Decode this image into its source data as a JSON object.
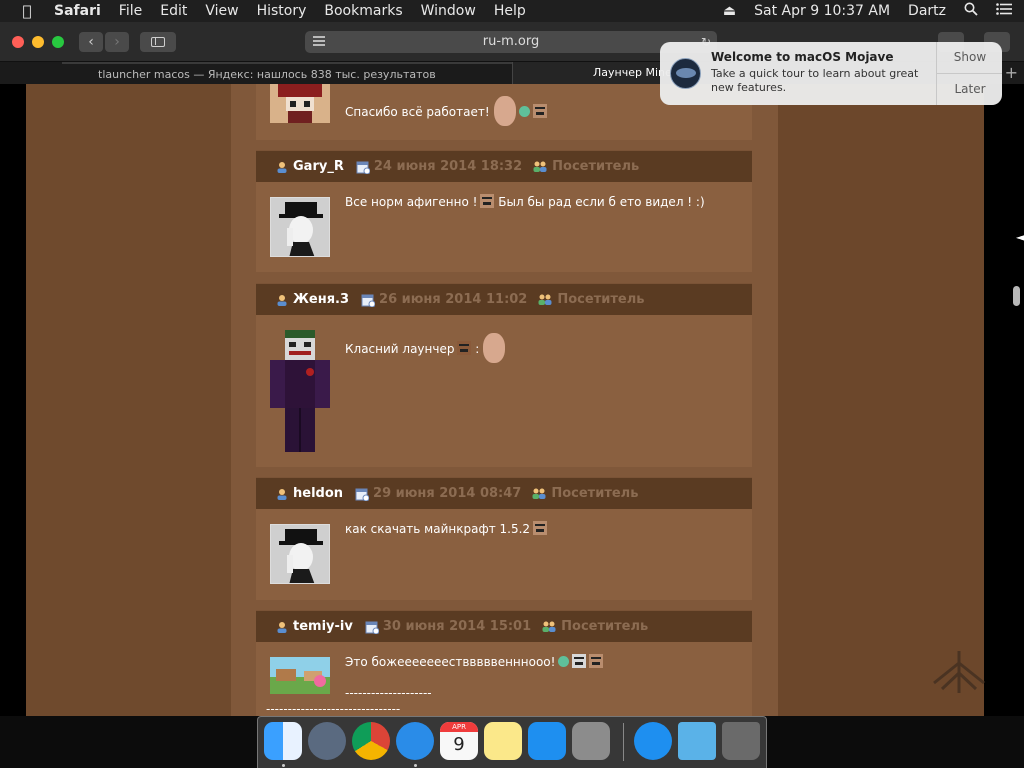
{
  "menubar": {
    "app": "Safari",
    "items": [
      "File",
      "Edit",
      "View",
      "History",
      "Bookmarks",
      "Window",
      "Help"
    ],
    "datetime": "Sat Apr 9  10:37 AM",
    "user": "Dartz"
  },
  "toolbar": {
    "url": "ru-m.org"
  },
  "tabs": {
    "inactive": "tlauncher macos — Яндекс: нашлось 838 тыс. результатов",
    "active": "Лаунчер Minecraft"
  },
  "notification": {
    "title": "Welcome to macOS Mojave",
    "body": "Take a quick tour to learn about great new features.",
    "show": "Show",
    "later": "Later"
  },
  "comments": [
    {
      "text": "Спасибо всё работает!"
    },
    {
      "user": "Gary_R",
      "date": "24 июня 2014 18:32",
      "group": "Посетитель",
      "text": "Все норм афигенно !",
      "text_after": "Был бы рад если б ето видел ! :)"
    },
    {
      "user": "Женя.3",
      "date": "26 июня 2014 11:02",
      "group": "Посетитель",
      "text": "Класний лаунчер",
      "text_after": ":"
    },
    {
      "user": "heldon",
      "date": "29 июня 2014 08:47",
      "group": "Посетитель",
      "text": "как скачать майнкрафт 1.5.2"
    },
    {
      "user": "temiy-iv",
      "date": "30 июня 2014 15:01",
      "group": "Посетитель",
      "text": "Это божееееееествввввенннооо!",
      "line2": "--------------------",
      "line3": "-------------------------------"
    }
  ],
  "dock": {
    "calendar_month": "APR",
    "calendar_day": "9"
  },
  "colors": {
    "page_bg": "#6c472b",
    "center_col": "#80583a",
    "comment_head": "#5a3b22",
    "comment_body": "#8a6040",
    "date_text": "#8c6c52"
  }
}
